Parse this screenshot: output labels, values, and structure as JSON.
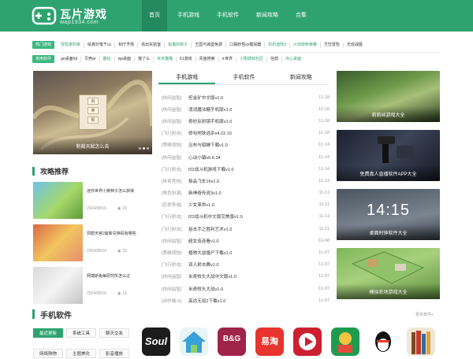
{
  "brand": {
    "name": "瓦片游戏",
    "domain": "wap1934.com",
    "accent": "#2ea36f"
  },
  "nav": [
    "首页",
    "手机游戏",
    "手机软件",
    "新闻攻略",
    "合集"
  ],
  "hot_games": {
    "tag": "热门游戏",
    "items": [
      "冒险家的家",
      "绘真妙笔千山",
      "旬厅予扬",
      "逃出实验室",
      "班鬼的房子",
      "王国与城堡免费",
      "口袋妖怪xy模拟器",
      "石石迷阵3",
      "火线使命荣耀",
      "烹饪冒险",
      "无双战姬"
    ]
  },
  "common_apps": {
    "tag": "常用软件",
    "items": [
      "go桌面hd",
      "贝壳ar",
      "趣玩",
      "wp桌面",
      "饿了么",
      "米米猫猫",
      "61游戏",
      "青鱼搜索",
      "rr世界",
      "小刚游戏社区",
      "信鸽",
      "点心桌面"
    ]
  },
  "banner": {
    "caption": "制裁天弑怎么去",
    "fan": [
      "剑",
      "拳",
      "枫"
    ]
  },
  "guides": {
    "title": "攻略推荐",
    "items": [
      {
        "title": "迷你世界小黄种子怎么获得",
        "date": "2024/08/16",
        "views": "20"
      },
      {
        "title": "洞窟天宫2最新兑换码有哪些",
        "date": "2024/08/16",
        "views": "15"
      },
      {
        "title": "网端斯兔每研究所怎么过",
        "date": "2024/08/16",
        "views": "13"
      }
    ]
  },
  "tabs": [
    "手机游戏",
    "手机软件",
    "新闻攻略"
  ],
  "list": [
    {
      "cat": "[休闲益智]",
      "name": "挖金矿中文版v1.0",
      "date": "11-18"
    },
    {
      "cat": "[休闲益智]",
      "name": "消消魔法糖手机版v1.0",
      "date": "11-18"
    },
    {
      "cat": "[休闲益智]",
      "name": "奇妙反射镜手机版v1.0",
      "date": "11-18"
    },
    {
      "cat": "[飞行射击]",
      "name": "修勾地铁逃杀v4.22.15",
      "date": "11-18"
    },
    {
      "cat": "[策略塔防]",
      "name": "吕布与貂蝉下载v1.0",
      "date": "11-14"
    },
    {
      "cat": "[休闲益智]",
      "name": "心动小镇v6.6.34",
      "date": "11-14"
    },
    {
      "cat": "[飞行射击]",
      "name": "f22战斗机游戏下载v1.0",
      "date": "11-14"
    },
    {
      "cat": "[体育竞技]",
      "name": "极品飞车16v1.0",
      "date": "11-13"
    },
    {
      "cat": "[角色扮演]",
      "name": "新神奇传说3v1.0",
      "date": "11-11"
    },
    {
      "cat": "[恋爱养成]",
      "name": "少女革命v1.0",
      "date": "11-11"
    },
    {
      "cat": "[飞行射击]",
      "name": "f22战斗机中文版完美版v1.0",
      "date": "11-11"
    },
    {
      "cat": "[飞行射击]",
      "name": "狙击手之胜利艺术v1.0",
      "date": "11-11"
    },
    {
      "cat": "[休闲益智]",
      "name": "超女连连看v1.0",
      "date": "11-08"
    },
    {
      "cat": "[策略塔防]",
      "name": "植物大战僵尸下载v1.0",
      "date": "11-07"
    },
    {
      "cat": "[飞行射击]",
      "name": "双人射击赛v1.0",
      "date": "11-07"
    },
    {
      "cat": "[休闲益智]",
      "name": "米奇牧头大战中文版v1.0",
      "date": "11-07"
    },
    {
      "cat": "[休闲益智]",
      "name": "米奇牧头大战v1.0",
      "date": "11-07"
    },
    {
      "cat": "[动作格斗]",
      "name": "高达无双2下载v1.0",
      "date": "11-07"
    }
  ],
  "cards": [
    "莉莉丝游戏大全",
    "免费真人直播软件APP大全",
    "桌面时钟软件大全",
    "模拟农场游戏大全"
  ],
  "clock": {
    "time": "14:15"
  },
  "software": {
    "title": "手机软件",
    "more": "更多软件+",
    "tags": [
      "最近更新",
      "系统工具",
      "聊天交友",
      "网络购物",
      "主题美化",
      "影音播放"
    ],
    "apps": [
      "Soul",
      "B&G",
      "易淘"
    ]
  }
}
